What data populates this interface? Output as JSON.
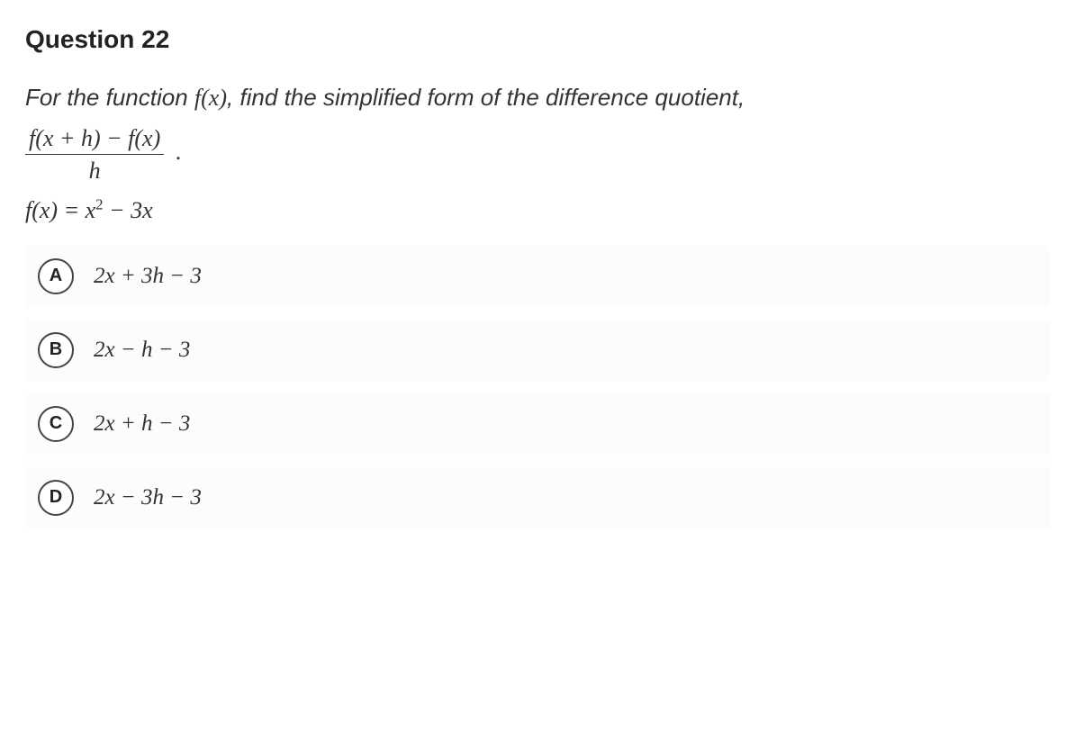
{
  "question": {
    "number_label": "Question 22",
    "prompt_lead": "For the function ",
    "prompt_func": "f(x)",
    "prompt_mid": ", find the simplified form of the difference quotient,",
    "frac_num": "f(x + h) − f(x)",
    "frac_den": "h",
    "frac_period": ".",
    "func_def_lhs": "f(x) = ",
    "func_def_rhs_a": "x",
    "func_def_rhs_exp": "2",
    "func_def_rhs_b": " − 3x"
  },
  "options": [
    {
      "letter": "A",
      "text": "2x + 3h − 3"
    },
    {
      "letter": "B",
      "text": "2x − h − 3"
    },
    {
      "letter": "C",
      "text": "2x + h − 3"
    },
    {
      "letter": "D",
      "text": "2x − 3h − 3"
    }
  ]
}
